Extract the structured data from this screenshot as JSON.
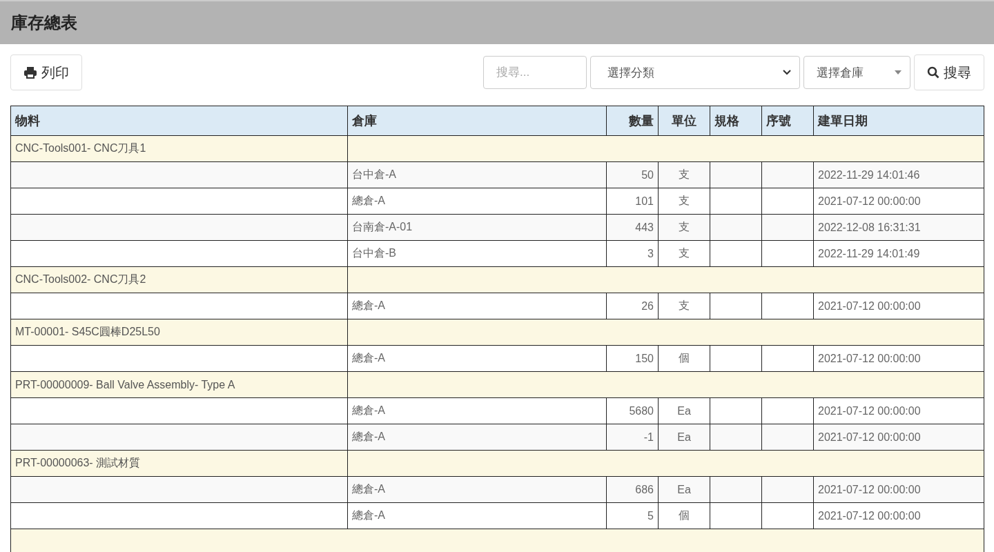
{
  "page": {
    "title": "庫存總表"
  },
  "toolbar": {
    "print_button": "列印",
    "search": {
      "placeholder": "搜尋..."
    },
    "category_select": {
      "value": "選擇分類"
    },
    "warehouse_select": {
      "value": "選擇倉庫"
    },
    "search_button": "搜尋"
  },
  "table": {
    "columns": [
      "物料",
      "倉庫",
      "數量",
      "單位",
      "規格",
      "序號",
      "建單日期"
    ],
    "groups": [
      {
        "material": "CNC-Tools001- CNC刀具1",
        "rows": [
          {
            "warehouse": "台中倉-A",
            "quantity": "50",
            "unit": "支",
            "created": "2022-11-29 14:01:46"
          },
          {
            "warehouse": "總倉-A",
            "quantity": "101",
            "unit": "支",
            "created": "2021-07-12 00:00:00"
          },
          {
            "warehouse": "台南倉-A-01",
            "quantity": "443",
            "unit": "支",
            "created": "2022-12-08 16:31:31"
          },
          {
            "warehouse": "台中倉-B",
            "quantity": "3",
            "unit": "支",
            "created": "2022-11-29 14:01:49"
          }
        ]
      },
      {
        "material": "CNC-Tools002- CNC刀具2",
        "rows": [
          {
            "warehouse": "總倉-A",
            "quantity": "26",
            "unit": "支",
            "created": "2021-07-12 00:00:00"
          }
        ]
      },
      {
        "material": "MT-00001- S45C圓棒D25L50",
        "rows": [
          {
            "warehouse": "總倉-A",
            "quantity": "150",
            "unit": "個",
            "created": "2021-07-12 00:00:00"
          }
        ]
      },
      {
        "material": "PRT-00000009- Ball Valve Assembly- Type A",
        "rows": [
          {
            "warehouse": "總倉-A",
            "quantity": "5680",
            "unit": "Ea",
            "created": "2021-07-12 00:00:00"
          },
          {
            "warehouse": "總倉-A",
            "quantity": "-1",
            "unit": "Ea",
            "created": "2021-07-12 00:00:00"
          }
        ]
      },
      {
        "material": "PRT-00000063- 測試材質",
        "rows": [
          {
            "warehouse": "總倉-A",
            "quantity": "686",
            "unit": "Ea",
            "created": "2021-07-12 00:00:00"
          },
          {
            "warehouse": "總倉-A",
            "quantity": "5",
            "unit": "個",
            "created": "2021-07-12 00:00:00"
          }
        ]
      }
    ]
  }
}
